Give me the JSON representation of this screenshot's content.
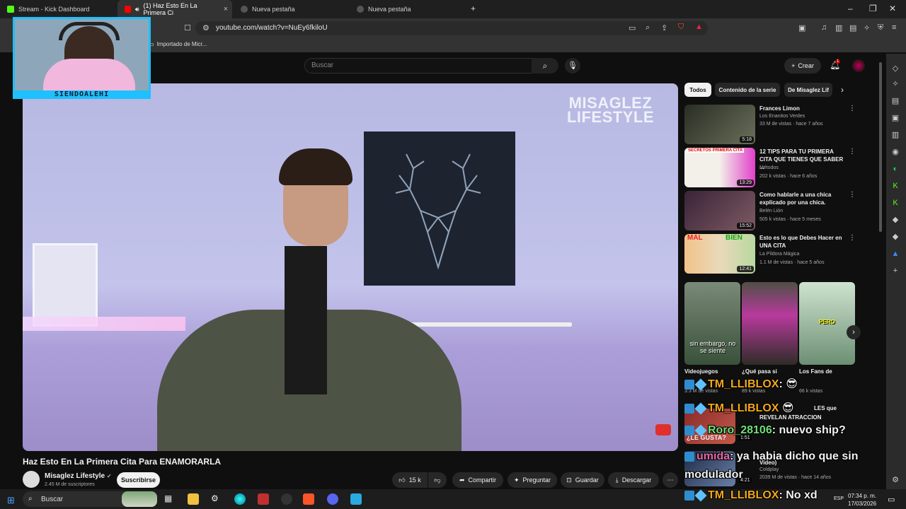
{
  "browser": {
    "tabs": [
      {
        "label": "Stream - Kick Dashboard",
        "active": false
      },
      {
        "label": "(1) Haz Esto En La Primera Ci",
        "active": true
      },
      {
        "label": "Nueva pestaña",
        "active": false
      },
      {
        "label": "Nueva pestaña",
        "active": false
      }
    ],
    "url": "youtube.com/watch?v=NuEy6fkiloU",
    "bookmark": "Importado de Micr..."
  },
  "youtube": {
    "search_placeholder": "Buscar",
    "create_label": "Crear",
    "notification_count": "1",
    "video": {
      "watermark_line1": "MISAGLEZ",
      "watermark_line2": "LIFESTYLE",
      "title": "Haz Esto En La Primera Cita Para ENAMORARLA",
      "channel": "Misaglez Lifestyle",
      "subscribers": "2.45 M de suscriptores",
      "subscribe_label": "Suscribirse",
      "likes": "15 k",
      "share_label": "Compartir",
      "ask_label": "Preguntar",
      "save_label": "Guardar",
      "download_label": "Descargar"
    },
    "chips": [
      "Todos",
      "Contenido de la serie",
      "De Misaglez Lif"
    ],
    "recommendations": [
      {
        "title": "Frances Limon",
        "channel": "Los Enanitos Verdes",
        "views": "33 M de vistas · hace 7 años",
        "duration": "5:18"
      },
      {
        "title": "12 TIPS PARA TU PRIMERA CITA QUE TIENES QUE SABER ...",
        "channel": "Métodos",
        "views": "202 k vistas · hace 6 años",
        "duration": "13:29",
        "thumb_text": "SECRETOS PRIMERA CITA"
      },
      {
        "title": "Como hablarle a una chica explicado por una chica.",
        "channel": "Belén Lión",
        "views": "505 k vistas · hace 5 meses",
        "duration": "15:52"
      },
      {
        "title": "Esto es lo que Debes Hacer en UNA CITA",
        "channel": "La Píldora Mágica",
        "views": "1.1 M de vistas · hace 5 años",
        "duration": "12:41",
        "thumb_text_left": "MAL",
        "thumb_text_right": "BIEN"
      }
    ],
    "shorts": [
      {
        "title": "Videojuegos",
        "views": "3.3 M de vistas",
        "caption": "sin embargo, no se siente"
      },
      {
        "title": "¿Qué pasa si",
        "views": "89 k vistas"
      },
      {
        "title": "Los Fans de",
        "views": "66 k vistas",
        "caption": "PERO"
      }
    ],
    "lower_rec": [
      {
        "title": "REVELAN ATRACCION",
        "channel": "Video)",
        "channel2": "Coldplay",
        "views": "2039 M de vistas · hace 14 años",
        "duration": "4:21",
        "duration2": "1:51"
      }
    ]
  },
  "stream_overlay": {
    "streamer_name": "SIENDOALEHI",
    "chat": [
      {
        "user": "TM_LLIBLOX",
        "message": ":",
        "user_color": "#f2a71b"
      },
      {
        "user": "TM_LLIBLOX",
        "message": "",
        "user_color": "#f2a71b"
      },
      {
        "user": "Roro_28106",
        "message": ": nuevo ship?",
        "user_color": "#6ee07a"
      },
      {
        "user": "umida",
        "message": ": ya habia dicho que sin modulador",
        "user_color": "#e56aa7"
      },
      {
        "user": "TM_LLIBLOX",
        "message": ": No xd",
        "user_color": "#f2a71b"
      }
    ],
    "chat_fragments": [
      "¿LE GUSTA?",
      "¿Qué pasa si",
      "LES que"
    ]
  },
  "taskbar": {
    "search_label": "Buscar",
    "time": "07:34 p. m.",
    "date": "17/03/2026",
    "lang": "ESP"
  },
  "colors": {
    "accent": "#1ec0ff",
    "youtube_red": "#ff0000",
    "kick_green": "#53fc18"
  }
}
